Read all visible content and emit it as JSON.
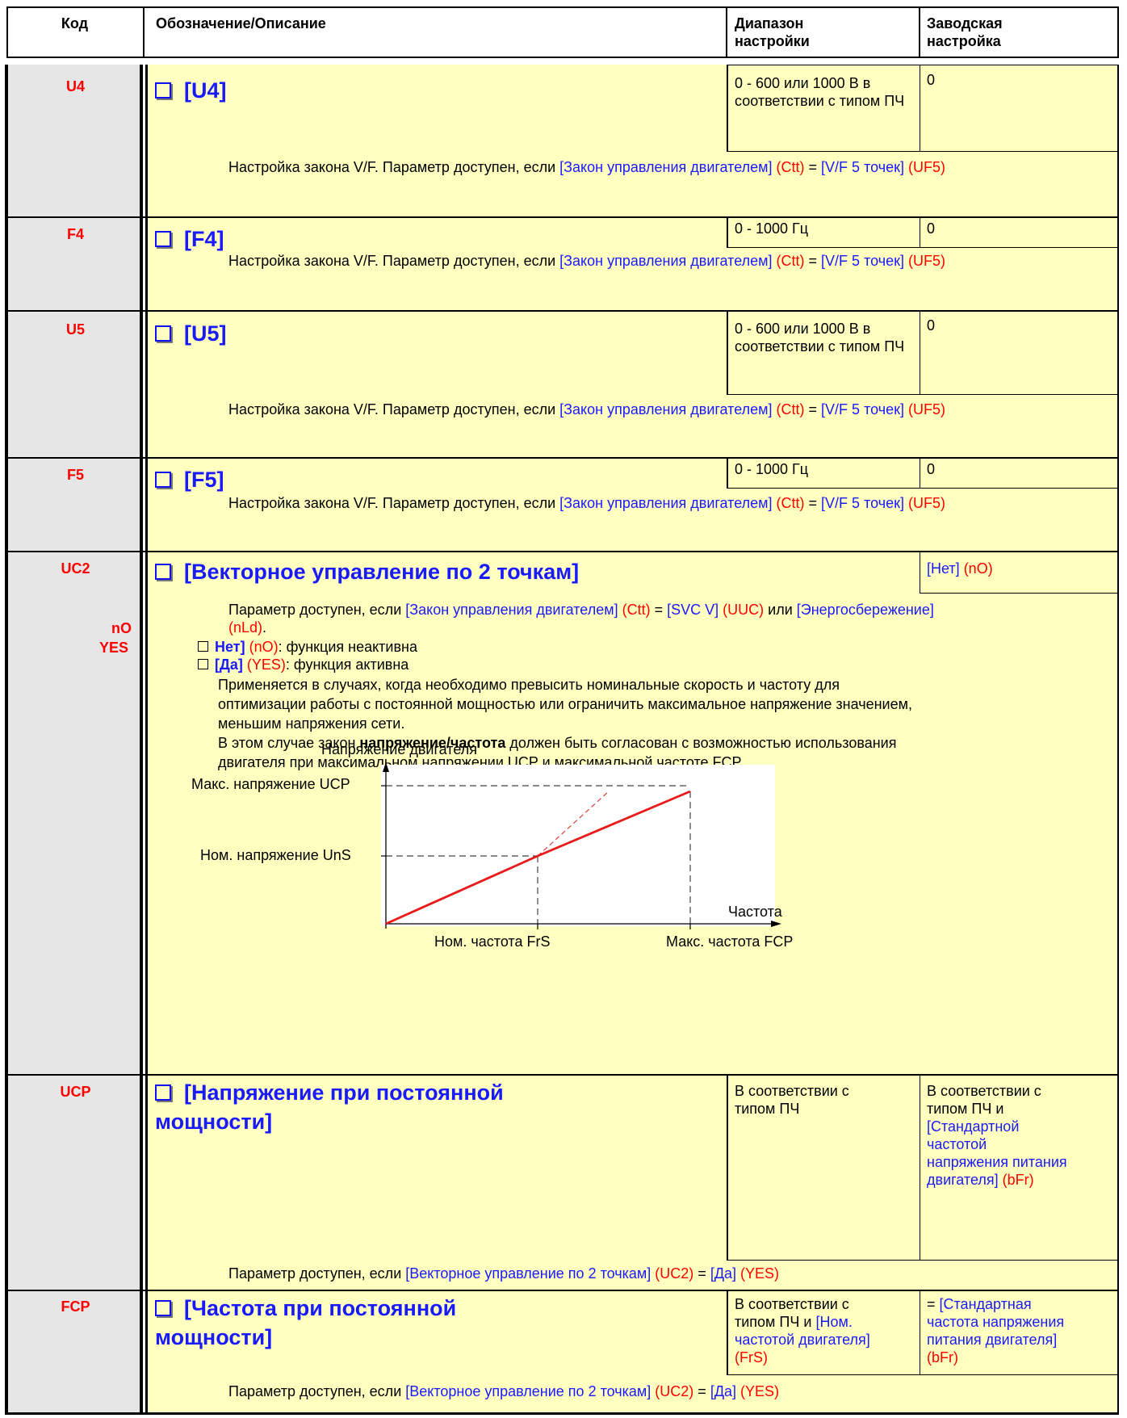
{
  "header": {
    "code": "Код",
    "name": "Обозначение/Описание",
    "range": "Диапазон настройки",
    "factory": "Заводская настройка"
  },
  "common": {
    "vf_prefix": "Настройка закона V/F. Параметр доступен, если ",
    "law": "[Закон управления двигателем]",
    "ctt": "(Ctt)",
    "eq": " = ",
    "vf5": "[V/F 5 точек]",
    "uf5": "(UF5)",
    "range_volt": "0 - 600 или 1000 В в соответствии с типом ПЧ",
    "range_freq": "0 - 1000 Гц",
    "zero": "0"
  },
  "rows": {
    "u4": {
      "code": "U4",
      "title": "[U4]"
    },
    "f4": {
      "code": "F4",
      "title": "[F4]"
    },
    "u5": {
      "code": "U5",
      "title": "[U5]"
    },
    "f5": {
      "code": "F5",
      "title": "[F5]"
    },
    "uc2": {
      "code": "UC2",
      "opt1": "nO",
      "opt2": "YES",
      "title": "[Векторное управление по 2 точкам]",
      "factory_label": "[Нет]",
      "factory_code": "(nO)",
      "d1a": "Параметр доступен, если ",
      "d1b": "[Закон управления двигателем]",
      "d1c": "(Ctt)",
      "d1d": " = ",
      "d1e": "[SVC V]",
      "d1f": "(UUC)",
      "d1g": " или ",
      "d1h": "[Энергосбережение]",
      "d1i": "(nLd)",
      "d1j": ".",
      "o1_label": "Нет]",
      "o1_code": "(nO)",
      "o1_text": ": функция неактивна",
      "o2_label": "[Да]",
      "o2_code": "(YES)",
      "o2_text": ": функция активна",
      "p1": "Применяется в случаях, когда необходимо превысить номинальные скорость и частоту для",
      "p2": "оптимизации работы с постоянной мощностью или ограничить максимальное напряжение значением,",
      "p3": "меньшим напряжения сети.",
      "p4a": "В этом случае закон ",
      "p4b": "напряжение/частота",
      "p4c": " должен быть согласован с возможностью использования",
      "p5": "двигателя при максимальном напряжении UCP и максимальной частоте FCP"
    },
    "ucp": {
      "code": "UCP",
      "title1": "[Напряжение при постоянной",
      "title2": "мощности]",
      "range1": "В соответствии с",
      "range2": "типом ПЧ",
      "f1": "В соответствии с",
      "f2": "типом ПЧ и",
      "f3": "[Стандартной",
      "f4": "частотой",
      "f5": "напряжения питания",
      "f6": "двигателя]",
      "f6b": "(bFr)",
      "d_a": "Параметр доступен, если ",
      "d_b": "[Векторное управление по 2 точкам]",
      "d_c": "(UC2)",
      "d_d": " = ",
      "d_e": "[Да]",
      "d_f": "(YES)"
    },
    "fcp": {
      "code": "FCP",
      "title1": "[Частота при постоянной",
      "title2": "мощности]",
      "r1": "В соответствии с",
      "r2a": "типом ПЧ и ",
      "r2b": "[Ном.",
      "r3": "частотой двигателя]",
      "r4": "(FrS)",
      "f1a": "= ",
      "f1b": "[Стандартная",
      "f2": "частота напряжения",
      "f3": "питания двигателя]",
      "f4": "(bFr)"
    }
  },
  "chart_data": {
    "type": "line",
    "title": "Напряжение двигателя",
    "xlabel": "Частота",
    "y_labels": [
      "Макс. напряжение UCP",
      "Ном. напряжение  UnS"
    ],
    "x_labels": [
      "Ном. частота FrS",
      "Макс. частота FCP"
    ],
    "series": [
      {
        "points": [
          [
            "0",
            "0"
          ],
          [
            "FrS",
            "UnS"
          ],
          [
            "FCP",
            "UCP"
          ]
        ]
      }
    ]
  }
}
